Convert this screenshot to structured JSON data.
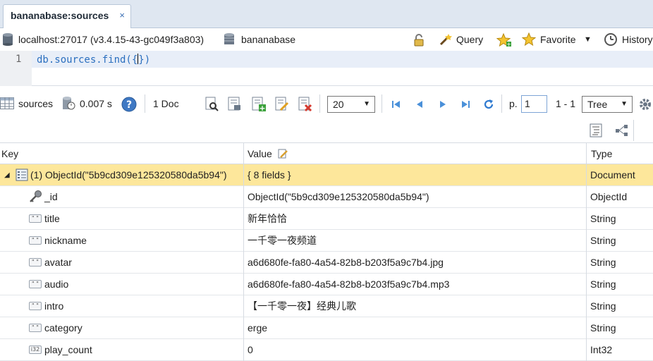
{
  "tab": {
    "title": "bananabase:sources",
    "close": "×"
  },
  "connection": {
    "host": "localhost:27017 (v3.4.15-43-gc049f3a803)",
    "database": "bananabase"
  },
  "toolbar": {
    "query": "Query",
    "favorite": "Favorite",
    "history": "History"
  },
  "editor": {
    "line_number": "1",
    "code_before": "db.sources.find({",
    "code_after": "})"
  },
  "results": {
    "collection": "sources",
    "time": "0.007 s",
    "doc_count": "1 Doc",
    "page_size": "20",
    "page_label": "p.",
    "page_value": "1",
    "range": "1 - 1",
    "view_mode": "Tree"
  },
  "grid": {
    "headers": {
      "key": "Key",
      "value": "Value",
      "type": "Type"
    },
    "document": {
      "key": "(1) ObjectId(\"5b9cd309e125320580da5b94\")",
      "value": "{ 8 fields }",
      "type": "Document"
    },
    "fields": [
      {
        "icon": "key-icon",
        "key": "_id",
        "value": "ObjectId(\"5b9cd309e125320580da5b94\")",
        "type": "ObjectId"
      },
      {
        "icon": "string-icon",
        "key": "title",
        "value": "新年恰恰",
        "type": "String"
      },
      {
        "icon": "string-icon",
        "key": "nickname",
        "value": "一千零一夜频道",
        "type": "String"
      },
      {
        "icon": "string-icon",
        "key": "avatar",
        "value": "a6d680fe-fa80-4a54-82b8-b203f5a9c7b4.jpg",
        "type": "String"
      },
      {
        "icon": "string-icon",
        "key": "audio",
        "value": "a6d680fe-fa80-4a54-82b8-b203f5a9c7b4.mp3",
        "type": "String"
      },
      {
        "icon": "string-icon",
        "key": "intro",
        "value": "【一千零一夜】经典儿歌",
        "type": "String"
      },
      {
        "icon": "string-icon",
        "key": "category",
        "value": "erge",
        "type": "String"
      },
      {
        "icon": "int32-icon",
        "key": "play_count",
        "value": "0",
        "type": "Int32"
      }
    ]
  },
  "colors": {
    "selected_row": "#fde79b",
    "accent": "#3b6fb4",
    "code": "#2b6fbf"
  }
}
